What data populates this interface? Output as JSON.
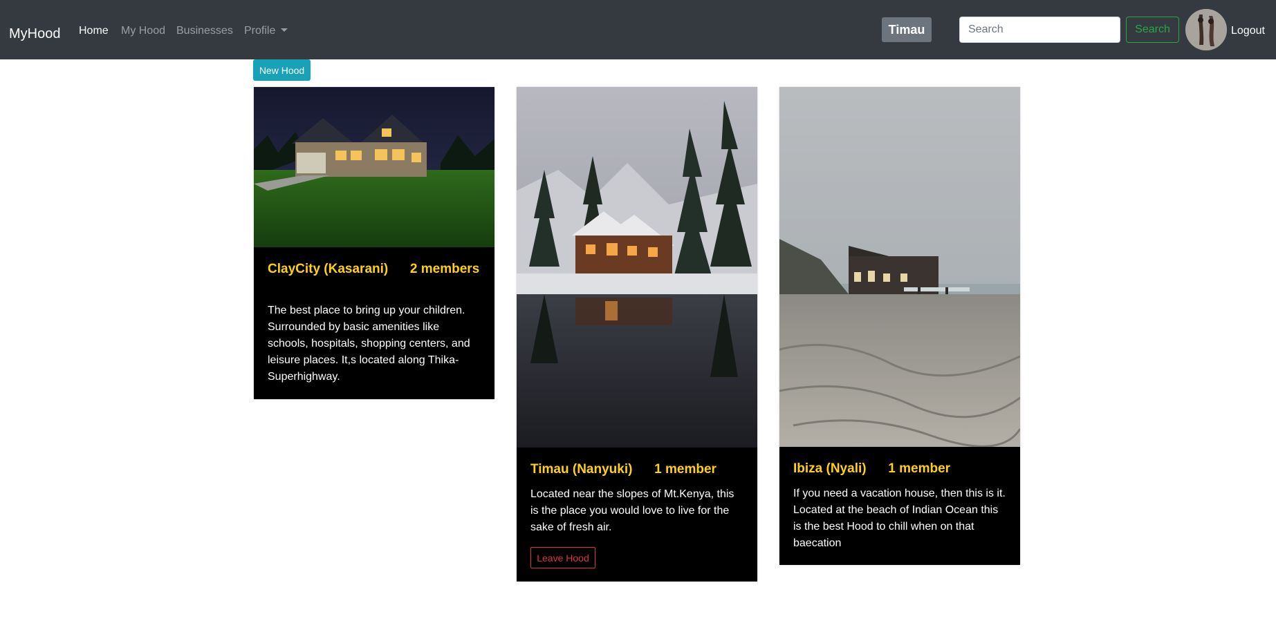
{
  "nav": {
    "brand": "MyHood",
    "links": [
      "Home",
      "My Hood",
      "Businesses",
      "Profile"
    ],
    "current_hood": "Timau",
    "search_placeholder": "Search",
    "search_button": "Search",
    "logout": "Logout"
  },
  "main": {
    "new_hood_button": "New Hood",
    "cards": [
      {
        "name": "ClayCity (Kasarani)",
        "members": "2 members",
        "description": "The best place to bring up your children. Surrounded by basic amenities like schools, hospitals, shopping centers, and leisure places. It,s located along Thika-Superhighway."
      },
      {
        "name": "Timau (Nanyuki)",
        "members": "1 member",
        "description": "Located near the slopes of Mt.Kenya, this is the place you would love to live for the sake of fresh air.",
        "action": "Leave Hood"
      },
      {
        "name": "Ibiza (Nyali)",
        "members": "1 member",
        "description": "If you need a vacation house, then this is it. Located at the beach of Indian Ocean this is the best Hood to chill when on that baecation"
      }
    ]
  },
  "colors": {
    "navbar": "#343a40",
    "title_accent": "#ffd10f",
    "new_hood": "#17a2b8",
    "search_green": "#28a745",
    "leave_red": "#dc3545"
  }
}
